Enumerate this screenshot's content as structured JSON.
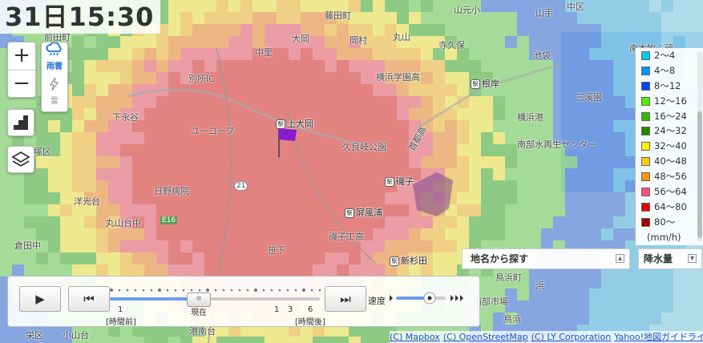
{
  "timestamp": "31日15:30",
  "controls": {
    "zoom_in": "+",
    "zoom_out": "−",
    "layer_rain": "雨雲",
    "layer_thunder": "雷"
  },
  "map_labels": {
    "places": [
      "藤田町",
      "山元小",
      "山手",
      "中区",
      "南本牧ふ頭",
      "前田町",
      "大岡",
      "岡村",
      "丸山",
      "寺久保",
      "池袋",
      "中里",
      "横浜学園高",
      "別所IC",
      "根岸",
      "下永谷",
      "横浜港",
      "三溪園",
      "ユーコープ",
      "上大岡",
      "久良岐公園",
      "南部水再生センター",
      "塚区",
      "日野病院",
      "磯子",
      "日野中央",
      "屏風浦",
      "洋光台",
      "磯子工高",
      "笹下",
      "新杉田",
      "丸山台中",
      "倉田中",
      "鳥浜町",
      "浜",
      "南部市場",
      "鳥浜",
      "港南台",
      "栄区",
      "小山台",
      "日野病院前"
    ],
    "route_tags": [
      "21",
      "E16"
    ],
    "highway": "首都高"
  },
  "legend": {
    "items": [
      {
        "label": "2〜4",
        "color": "#00c8f0"
      },
      {
        "label": "4〜8",
        "color": "#0096ff"
      },
      {
        "label": "8〜12",
        "color": "#0041ff"
      },
      {
        "label": "12〜16",
        "color": "#50f000"
      },
      {
        "label": "16〜24",
        "color": "#35b900"
      },
      {
        "label": "24〜32",
        "color": "#208a00"
      },
      {
        "label": "32〜40",
        "color": "#fff000"
      },
      {
        "label": "40〜48",
        "color": "#ffc800"
      },
      {
        "label": "48〜56",
        "color": "#ff9600"
      },
      {
        "label": "56〜64",
        "color": "#ff5078"
      },
      {
        "label": "64〜80",
        "color": "#e60000"
      },
      {
        "label": "80〜",
        "color": "#a00000"
      }
    ],
    "unit": "(mm/h)"
  },
  "search": {
    "place_label": "地名から探す",
    "rain_label": "降水量"
  },
  "player": {
    "play": "▶",
    "prev": "⏮",
    "next": "⏭",
    "speed_label": "速度",
    "tick_1": "1",
    "tick_past": "[時間前]",
    "tick_now": "現在",
    "tick_1b": "1",
    "tick_3": "3",
    "tick_6": "6",
    "tick_future": "[時間後]"
  },
  "attribution": [
    "(C) Mapbox",
    "(C) OpenStreetMap",
    "(C) LY Corporation",
    "Yahoo!地図ガイドライン"
  ]
}
